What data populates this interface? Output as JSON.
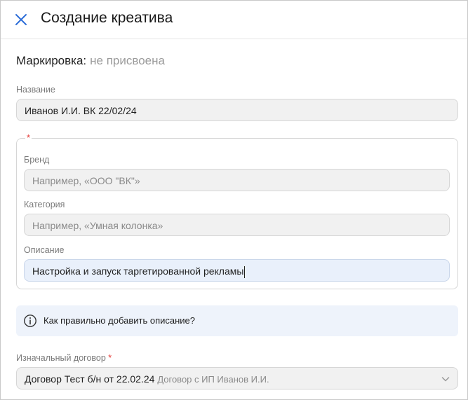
{
  "header": {
    "title": "Создание креатива",
    "close_icon": "close-icon"
  },
  "marking": {
    "label": "Маркировка:",
    "value": "не присвоена"
  },
  "name_field": {
    "label": "Название",
    "value": "Иванов И.И. ВК 22/02/24"
  },
  "group": {
    "required_mark": "*",
    "brand": {
      "label": "Бренд",
      "placeholder": "Например, «ООО \"ВК\"»"
    },
    "category": {
      "label": "Категория",
      "placeholder": "Например,  «Умная колонка»"
    },
    "description": {
      "label": "Описание",
      "value": "Настройка и запуск таргетированной рекламы"
    }
  },
  "info": {
    "icon": "info-icon",
    "text": "Как правильно добавить описание?"
  },
  "contract": {
    "label": "Изначальный договор",
    "required_mark": "*",
    "value": "Договор Тест б/н от 22.02.24",
    "subtext": "Договор с ИП Иванов И.И.",
    "icon": "chevron-down-icon"
  },
  "colors": {
    "accent": "#2f6fd8",
    "required": "#e53935",
    "info_bg": "#eef3fb"
  }
}
